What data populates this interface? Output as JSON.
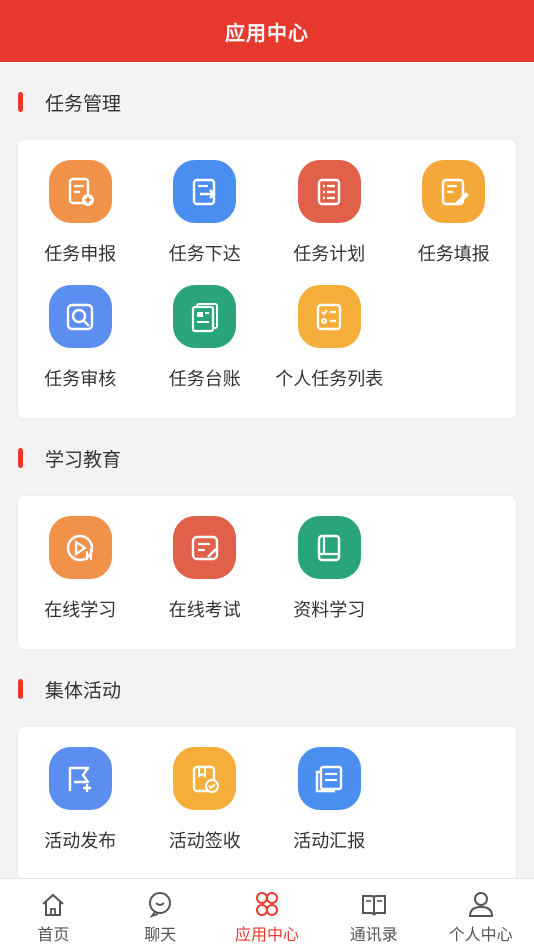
{
  "header": {
    "title": "应用中心"
  },
  "sections": [
    {
      "title": "任务管理",
      "items": [
        {
          "label": "任务申报",
          "icon": "task-report-icon",
          "color": "#f0924a"
        },
        {
          "label": "任务下达",
          "icon": "task-assign-icon",
          "color": "#4a8ff0"
        },
        {
          "label": "任务计划",
          "icon": "task-plan-icon",
          "color": "#e0604a"
        },
        {
          "label": "任务填报",
          "icon": "task-fill-icon",
          "color": "#f5a83a"
        },
        {
          "label": "任务审核",
          "icon": "task-review-icon",
          "color": "#5b8ef0"
        },
        {
          "label": "任务台账",
          "icon": "task-ledger-icon",
          "color": "#2aa57a"
        },
        {
          "label": "个人任务列表",
          "icon": "personal-task-list-icon",
          "color": "#f5ae3a"
        }
      ]
    },
    {
      "title": "学习教育",
      "items": [
        {
          "label": "在线学习",
          "icon": "online-learning-icon",
          "color": "#f0924a"
        },
        {
          "label": "在线考试",
          "icon": "online-exam-icon",
          "color": "#e0604a"
        },
        {
          "label": "资料学习",
          "icon": "material-study-icon",
          "color": "#2aa57a"
        }
      ]
    },
    {
      "title": "集体活动",
      "items": [
        {
          "label": "活动发布",
          "icon": "activity-publish-icon",
          "color": "#5b8ef0"
        },
        {
          "label": "活动签收",
          "icon": "activity-signin-icon",
          "color": "#f5ae3a"
        },
        {
          "label": "活动汇报",
          "icon": "activity-report-icon",
          "color": "#4a8ff0"
        }
      ]
    }
  ],
  "tabbar": {
    "items": [
      {
        "label": "首页",
        "icon": "home-icon",
        "active": false
      },
      {
        "label": "聊天",
        "icon": "chat-icon",
        "active": false
      },
      {
        "label": "应用中心",
        "icon": "app-center-icon",
        "active": true
      },
      {
        "label": "通讯录",
        "icon": "contacts-icon",
        "active": false
      },
      {
        "label": "个人中心",
        "icon": "profile-icon",
        "active": false
      }
    ],
    "active_color": "#e8392f",
    "inactive_color": "#555555"
  }
}
